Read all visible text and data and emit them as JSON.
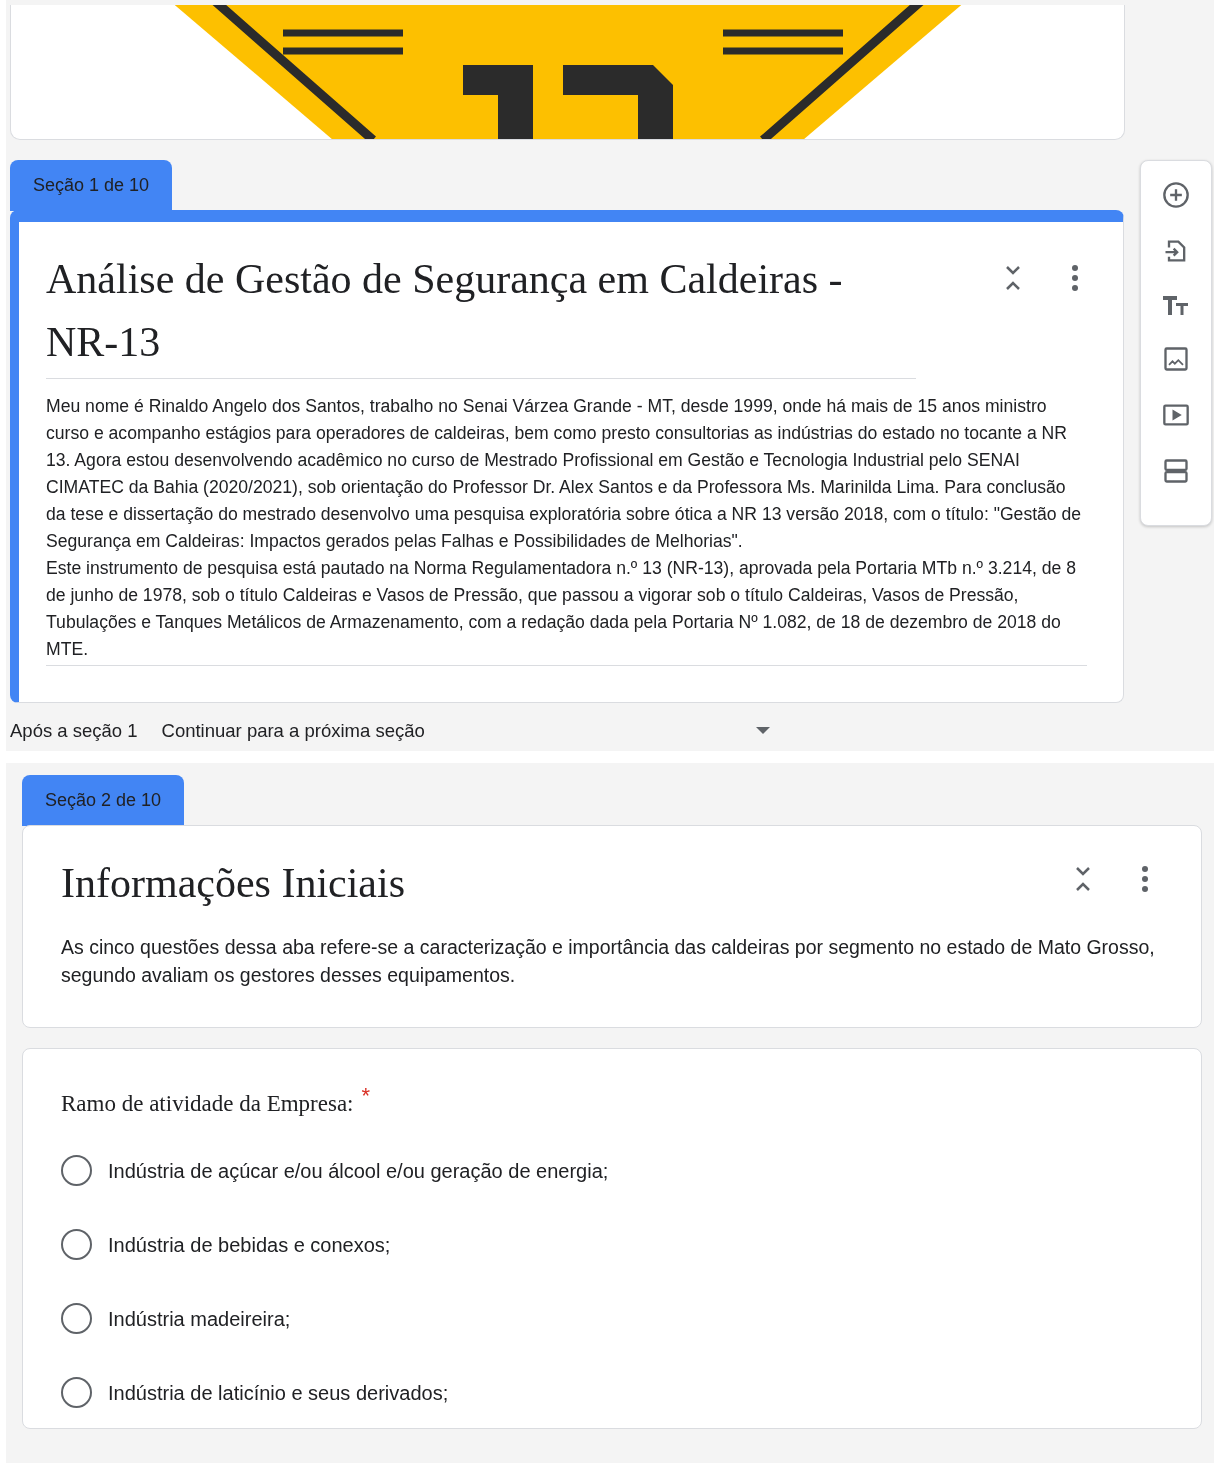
{
  "sections": [
    {
      "tab": "Seção 1 de 10",
      "selected": true,
      "title": "Análise de Gestão de Segurança em Caldeiras - NR-13",
      "description": "Meu nome é Rinaldo Angelo dos Santos, trabalho no Senai Várzea Grande - MT, desde 1999, onde há mais de 15 anos ministro curso e acompanho estágios para operadores de caldeiras, bem como presto consultorias as indústrias do estado no tocante a NR 13. Agora estou desenvolvendo acadêmico no curso de Mestrado Profissional em Gestão e Tecnologia Industrial pelo SENAI CIMATEC da Bahia (2020/2021), sob orientação do Professor Dr. Alex Santos e da Professora Ms. Marinilda Lima. Para conclusão da tese e dissertação do mestrado desenvolvo uma pesquisa exploratória sobre ótica a NR 13 versão 2018, com o título: \"Gestão de Segurança em Caldeiras: Impactos gerados pelas Falhas e Possibilidades de Melhorias\".\nEste instrumento de pesquisa está pautado na Norma Regulamentadora n.º 13 (NR-13), aprovada pela Portaria MTb n.º 3.214, de 8 de junho de 1978, sob o título Caldeiras e Vasos de Pressão, que passou a vigorar sob o título Caldeiras, Vasos de Pressão, Tubulações e Tanques Metálicos de Armazenamento, com a redação dada pela Portaria Nº 1.082, de 18 de dezembro de 2018 do MTE.",
      "after_label": "Após a seção 1",
      "after_value": "Continuar para a próxima seção"
    },
    {
      "tab": "Seção 2 de 10",
      "selected": false,
      "title": "Informações Iniciais",
      "description": "As cinco questões dessa aba refere-se a caracterização e importância das caldeiras por segmento no estado de Mato Grosso, segundo avaliam os gestores desses equipamentos.",
      "questions": [
        {
          "title": "Ramo de atividade da Empresa:",
          "required": true,
          "required_mark": "*",
          "options": [
            {
              "label": "Indústria de açúcar e/ou álcool e/ou geração de energia;",
              "selected": false
            },
            {
              "label": "Indústria de bebidas e conexos;",
              "selected": false
            },
            {
              "label": "Indústria madeireira;",
              "selected": false
            },
            {
              "label": "Indústria de laticínio e seus derivados;",
              "selected": false
            }
          ]
        }
      ]
    }
  ]
}
